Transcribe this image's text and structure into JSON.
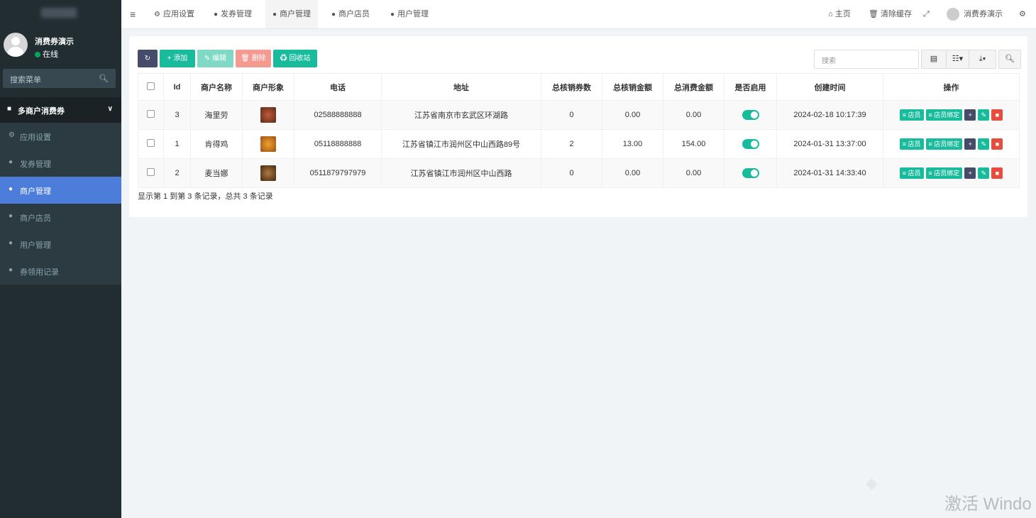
{
  "sidebar": {
    "user_name": "消费券演示",
    "user_status": "在线",
    "search_placeholder": "搜索菜单",
    "section_title": "多商户消费券",
    "items": [
      {
        "label": "应用设置"
      },
      {
        "label": "发券管理"
      },
      {
        "label": "商户管理",
        "active": true
      },
      {
        "label": "商户店员"
      },
      {
        "label": "用户管理"
      },
      {
        "label": "券领用记录"
      }
    ]
  },
  "topbar": {
    "tabs": [
      "应用设置",
      "发券管理",
      "商户管理",
      "商户店员",
      "用户管理"
    ],
    "home": "主页",
    "clear_cache": "清除缓存",
    "user_name": "消费券演示"
  },
  "toolbar": {
    "add": "添加",
    "edit": "编辑",
    "delete": "删除",
    "recycle": "回收站",
    "search_placeholder": "搜索"
  },
  "table": {
    "headers": [
      "Id",
      "商户名称",
      "商户形象",
      "电话",
      "地址",
      "总核销券数",
      "总核销金额",
      "总消费金额",
      "是否启用",
      "创建时间",
      "操作"
    ],
    "rows": [
      {
        "id": "3",
        "name": "海里劳",
        "phone": "02588888888",
        "address": "江苏省南京市玄武区环湖路",
        "coupons": "0",
        "amount": "0.00",
        "consume": "0.00",
        "enabled": true,
        "created": "2024-02-18 10:17:39"
      },
      {
        "id": "1",
        "name": "肯得鸡",
        "phone": "05118888888",
        "address": "江苏省镇江市润州区中山西路89号",
        "coupons": "2",
        "amount": "13.00",
        "consume": "154.00",
        "enabled": true,
        "created": "2024-01-31 13:37:00"
      },
      {
        "id": "2",
        "name": "麦当娜",
        "phone": "0511879797979",
        "address": "江苏省镇江市润州区中山西路",
        "coupons": "0",
        "amount": "0.00",
        "consume": "0.00",
        "enabled": true,
        "created": "2024-01-31 14:33:40"
      }
    ],
    "op_labels": {
      "staff": "店员",
      "staff_bind": "店员绑定"
    }
  },
  "summary": "显示第 1 到第 3 条记录，总共 3 条记录",
  "watermark": "激活 Windo",
  "colors": {
    "accent": "#18bc9c",
    "sidebar": "#222d32",
    "active": "#4d7ddb",
    "danger": "#e74c3c"
  }
}
